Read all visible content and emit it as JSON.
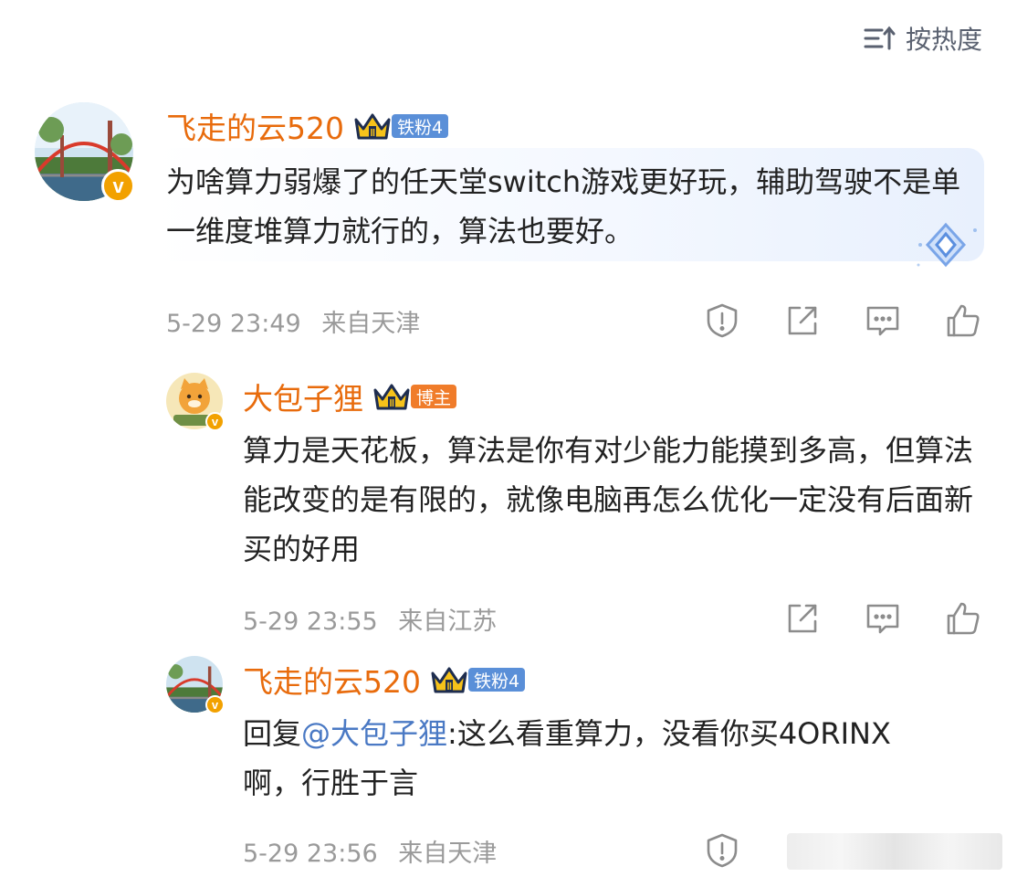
{
  "sort": {
    "label": "按热度",
    "icon": "sort-icon"
  },
  "comments": [
    {
      "username": "飞走的云520",
      "badge": "铁粉4",
      "text": "为啥算力弱爆了的任天堂switch游戏更好玩，辅助驾驶不是单一维度堆算力就行的，算法也要好。",
      "date": "5-29 23:49",
      "location": "来自天津",
      "actions": [
        "report-icon",
        "share-icon",
        "comment-icon",
        "like-icon"
      ]
    },
    {
      "username": "大包子狸",
      "badge": "博主",
      "text": "算力是天花板，算法是你有对少能力能摸到多高，但算法能改变的是有限的，就像电脑再怎么优化一定没有后面新买的好用",
      "date": "5-29 23:55",
      "location": "来自江苏",
      "actions": [
        "share-icon",
        "comment-icon",
        "like-icon"
      ]
    },
    {
      "username": "飞走的云520",
      "badge": "铁粉4",
      "reply_prefix": "回复",
      "mention": "@大包子狸",
      "text": ":这么看重算力，没看你买4ORINX啊，行胜于言",
      "date": "5-29 23:56",
      "location": "来自天津",
      "actions": [
        "report-icon",
        "share-icon",
        "comment-icon"
      ]
    }
  ],
  "colors": {
    "username": "#e86b0c",
    "mention": "#4a79c4",
    "meta": "#9a9a9a",
    "iron_badge": "#5a8fd8",
    "host_badge": "#f07c2a"
  }
}
